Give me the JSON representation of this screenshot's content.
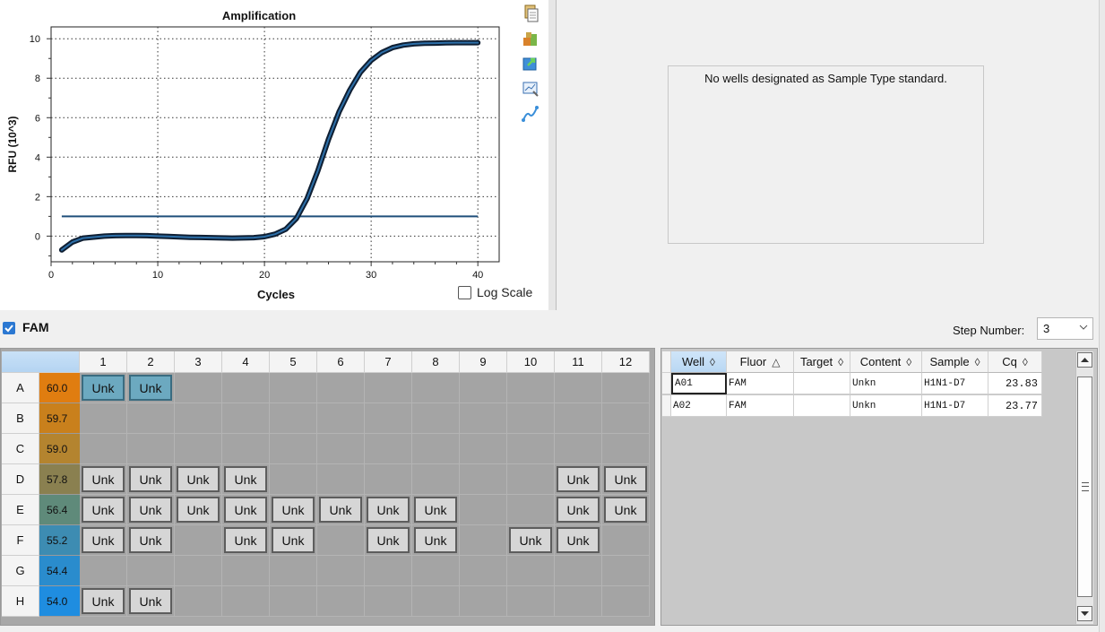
{
  "chart_data": {
    "type": "line",
    "title": "Amplification",
    "xlabel": "Cycles",
    "ylabel": "RFU (10^3)",
    "xlim": [
      0,
      42
    ],
    "ylim": [
      -1.3,
      10.6
    ],
    "xticks": [
      "0",
      "10",
      "20",
      "30",
      "40"
    ],
    "yticks": [
      "0",
      "2",
      "4",
      "6",
      "8",
      "10"
    ],
    "grid": true,
    "threshold": 1.0,
    "series": [
      {
        "values_x": [
          1,
          2,
          3,
          4,
          5,
          6,
          7,
          8,
          9,
          10,
          11,
          12,
          13,
          14,
          15,
          16,
          17,
          18,
          19,
          20,
          21,
          22,
          23,
          24,
          25,
          26,
          27,
          28,
          29,
          30,
          31,
          32,
          33,
          34,
          35,
          36,
          37,
          38,
          39,
          40
        ],
        "values_y": [
          -0.7,
          -0.3,
          -0.1,
          -0.05,
          0.0,
          0.02,
          0.03,
          0.03,
          0.02,
          0.0,
          -0.02,
          -0.04,
          -0.06,
          -0.07,
          -0.08,
          -0.09,
          -0.1,
          -0.09,
          -0.08,
          -0.03,
          0.1,
          0.35,
          0.9,
          1.9,
          3.3,
          4.9,
          6.3,
          7.4,
          8.3,
          8.9,
          9.3,
          9.55,
          9.68,
          9.74,
          9.77,
          9.78,
          9.79,
          9.8,
          9.8,
          9.8
        ]
      }
    ]
  },
  "chart_toolbar": {
    "icons": [
      "copy-icon",
      "settings-icon",
      "export-icon",
      "zoom-icon",
      "curve-icon"
    ]
  },
  "log_scale_label": "Log Scale",
  "standard_curve_message": "No wells designated as Sample Type standard.",
  "fluor": {
    "label": "FAM",
    "checked": true
  },
  "step": {
    "label": "Step Number:",
    "value": "3"
  },
  "plate": {
    "columns": [
      "1",
      "2",
      "3",
      "4",
      "5",
      "6",
      "7",
      "8",
      "9",
      "10",
      "11",
      "12"
    ],
    "rows": [
      {
        "label": "A",
        "temp": "60.0",
        "temp_color": "#e07d10",
        "wells": [
          "Unk",
          "Unk",
          "",
          "",
          "",
          "",
          "",
          "",
          "",
          "",
          "",
          ""
        ],
        "selected": [
          0,
          1
        ]
      },
      {
        "label": "B",
        "temp": "59.7",
        "temp_color": "#c9801c",
        "wells": [
          "",
          "",
          "",
          "",
          "",
          "",
          "",
          "",
          "",
          "",
          "",
          ""
        ],
        "selected": []
      },
      {
        "label": "C",
        "temp": "59.0",
        "temp_color": "#b4842f",
        "wells": [
          "",
          "",
          "",
          "",
          "",
          "",
          "",
          "",
          "",
          "",
          "",
          ""
        ],
        "selected": []
      },
      {
        "label": "D",
        "temp": "57.8",
        "temp_color": "#8a8050",
        "wells": [
          "Unk",
          "Unk",
          "Unk",
          "Unk",
          "",
          "",
          "",
          "",
          "",
          "",
          "Unk",
          "Unk"
        ],
        "selected": []
      },
      {
        "label": "E",
        "temp": "56.4",
        "temp_color": "#5f8a7a",
        "wells": [
          "Unk",
          "Unk",
          "Unk",
          "Unk",
          "Unk",
          "Unk",
          "Unk",
          "Unk",
          "",
          "",
          "Unk",
          "Unk"
        ],
        "selected": []
      },
      {
        "label": "F",
        "temp": "55.2",
        "temp_color": "#3d8cb2",
        "wells": [
          "Unk",
          "Unk",
          "",
          "Unk",
          "Unk",
          "",
          "Unk",
          "Unk",
          "",
          "Unk",
          "Unk",
          ""
        ],
        "selected": []
      },
      {
        "label": "G",
        "temp": "54.4",
        "temp_color": "#2a8ccd",
        "wells": [
          "",
          "",
          "",
          "",
          "",
          "",
          "",
          "",
          "",
          "",
          "",
          ""
        ],
        "selected": []
      },
      {
        "label": "H",
        "temp": "54.0",
        "temp_color": "#1f8de0",
        "wells": [
          "Unk",
          "Unk",
          "",
          "",
          "",
          "",
          "",
          "",
          "",
          "",
          "",
          ""
        ],
        "selected": []
      }
    ]
  },
  "results_table": {
    "columns": [
      {
        "label": "Well",
        "sort": "◊"
      },
      {
        "label": "Fluor",
        "sort": "△"
      },
      {
        "label": "Target",
        "sort": "◊"
      },
      {
        "label": "Content",
        "sort": "◊"
      },
      {
        "label": "Sample",
        "sort": "◊"
      },
      {
        "label": "Cq",
        "sort": "◊"
      }
    ],
    "rows": [
      {
        "well": "A01",
        "fluor": "FAM",
        "target": "",
        "content": "Unkn",
        "sample": "H1N1-D7",
        "cq": "23.83"
      },
      {
        "well": "A02",
        "fluor": "FAM",
        "target": "",
        "content": "Unkn",
        "sample": "H1N1-D7",
        "cq": "23.77"
      }
    ]
  }
}
